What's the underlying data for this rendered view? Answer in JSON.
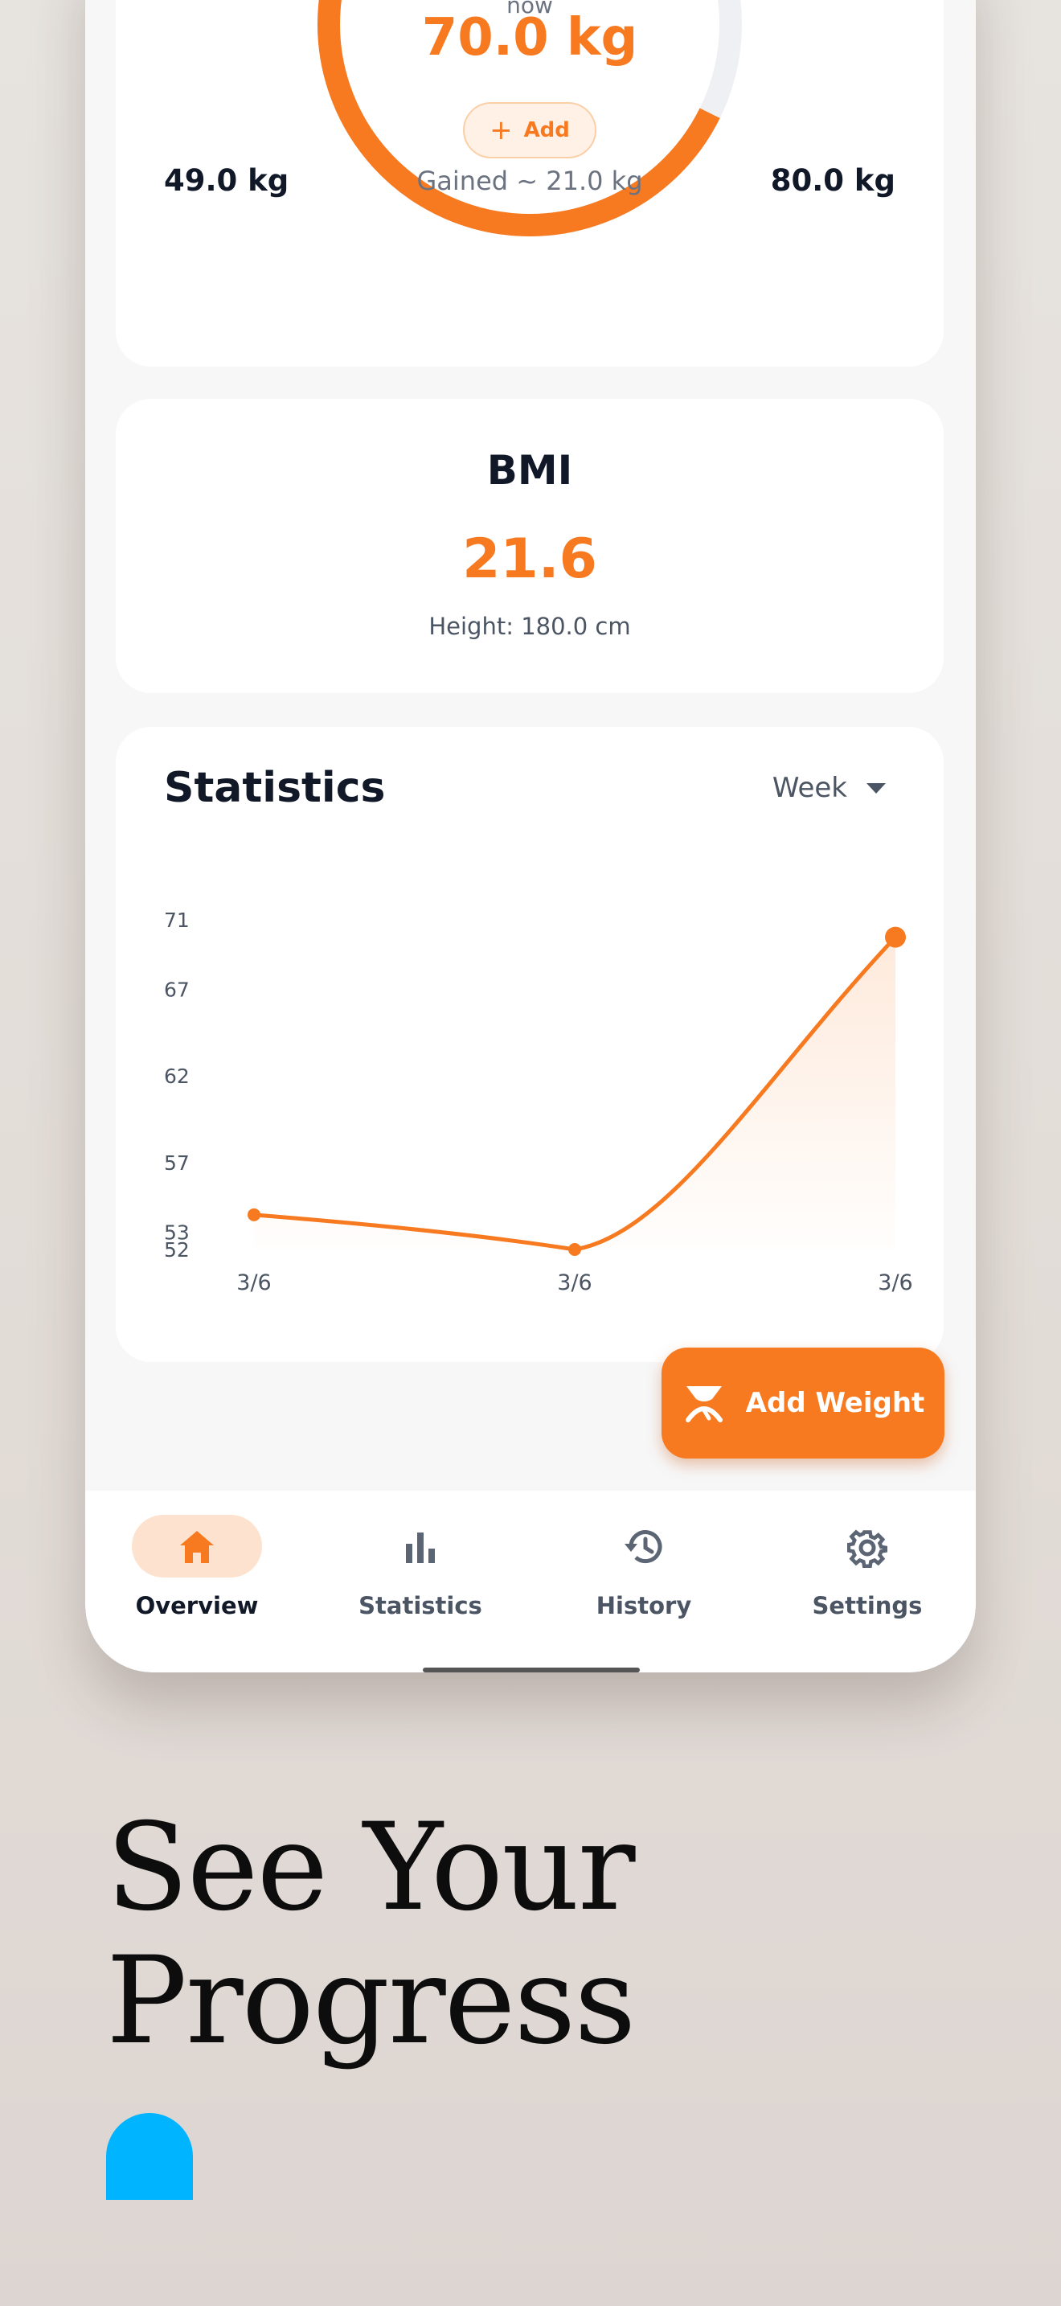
{
  "gauge": {
    "now_label": "now",
    "current_weight": "70.0 kg",
    "add_label": "Add",
    "start_weight": "49.0 kg",
    "gained_text": "Gained ~ 21.0 kg",
    "goal_weight": "80.0 kg",
    "progress": 0.677
  },
  "bmi": {
    "title": "BMI",
    "value": "21.6",
    "height_text": "Height: 180.0 cm"
  },
  "statistics": {
    "title": "Statistics",
    "period": "Week"
  },
  "chart_data": {
    "type": "area",
    "title": "",
    "yticks": [
      "71",
      "67",
      "62",
      "57",
      "53",
      "52"
    ],
    "categories": [
      "3/6",
      "3/6",
      "3/6"
    ],
    "series": [
      {
        "values": [
          54,
          52,
          70
        ]
      }
    ],
    "ylim": [
      52,
      71
    ],
    "grid": false
  },
  "fab": {
    "label": "Add Weight"
  },
  "nav": {
    "items": [
      {
        "label": "Overview"
      },
      {
        "label": "Statistics"
      },
      {
        "label": "History"
      },
      {
        "label": "Settings"
      }
    ]
  },
  "promo": {
    "headline_line1": "See Your",
    "headline_line2": "Progress"
  },
  "colors": {
    "accent": "#f77a21",
    "accent_light": "#fde3cf",
    "brand_blue": "#00b4ff"
  }
}
